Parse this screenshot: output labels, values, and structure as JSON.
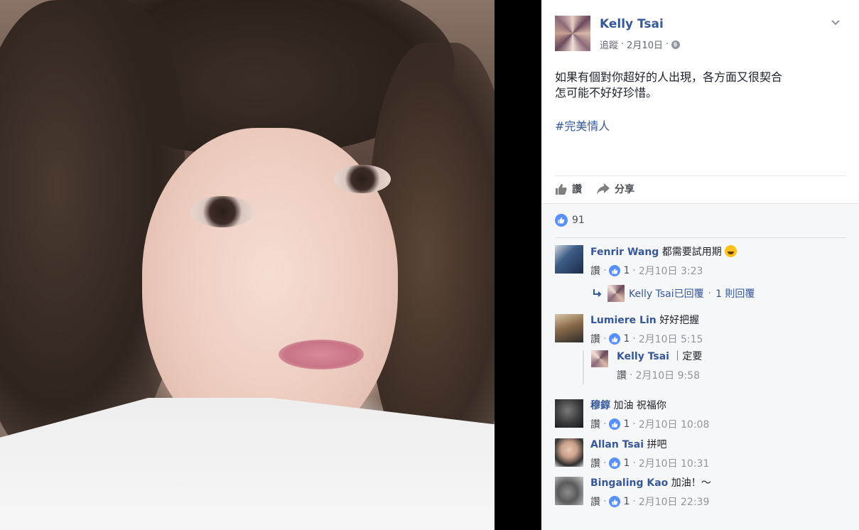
{
  "post": {
    "author": "Kelly Tsai",
    "follow_label": "追蹤",
    "date": "2月10日",
    "dot": "·",
    "text_line1": "如果有個對你超好的人出現，各方面又很契合",
    "text_line2": "怎可能不好好珍惜。",
    "hashtag": "#完美情人",
    "like_action": "讚",
    "share_action": "分享",
    "like_count": "91"
  },
  "colors": {
    "link": "#365899",
    "like_blue": "#5890ff",
    "meta_gray": "#90949c"
  },
  "comments": [
    {
      "name": "Fenrir Wang",
      "text": "都需要試用期",
      "emoji": "face-with-tears-of-joy",
      "like_label": "讚",
      "likes": "1",
      "time": "2月10日 3:23",
      "reply_summary": {
        "author_text": "Kelly Tsai已回覆",
        "dot": "·",
        "count_text": "1 則回覆"
      }
    },
    {
      "name": "Lumiere Lin",
      "text": "好好把握",
      "like_label": "讚",
      "likes": "1",
      "time": "2月10日 5:15",
      "reply": {
        "name": "Kelly Tsai",
        "text": "｜定要",
        "like_label": "讚",
        "time": "2月10日 9:58"
      }
    },
    {
      "name": "穆錞",
      "text": "加油 祝福你",
      "like_label": "讚",
      "likes": "1",
      "time": "2月10日 10:08"
    },
    {
      "name": "Allan Tsai",
      "text": "拼吧",
      "like_label": "讚",
      "likes": "1",
      "time": "2月10日 10:31"
    },
    {
      "name": "Bingaling Kao",
      "text": "加油！～",
      "like_label": "讚",
      "likes": "1",
      "time": "2月10日 22:39"
    }
  ]
}
